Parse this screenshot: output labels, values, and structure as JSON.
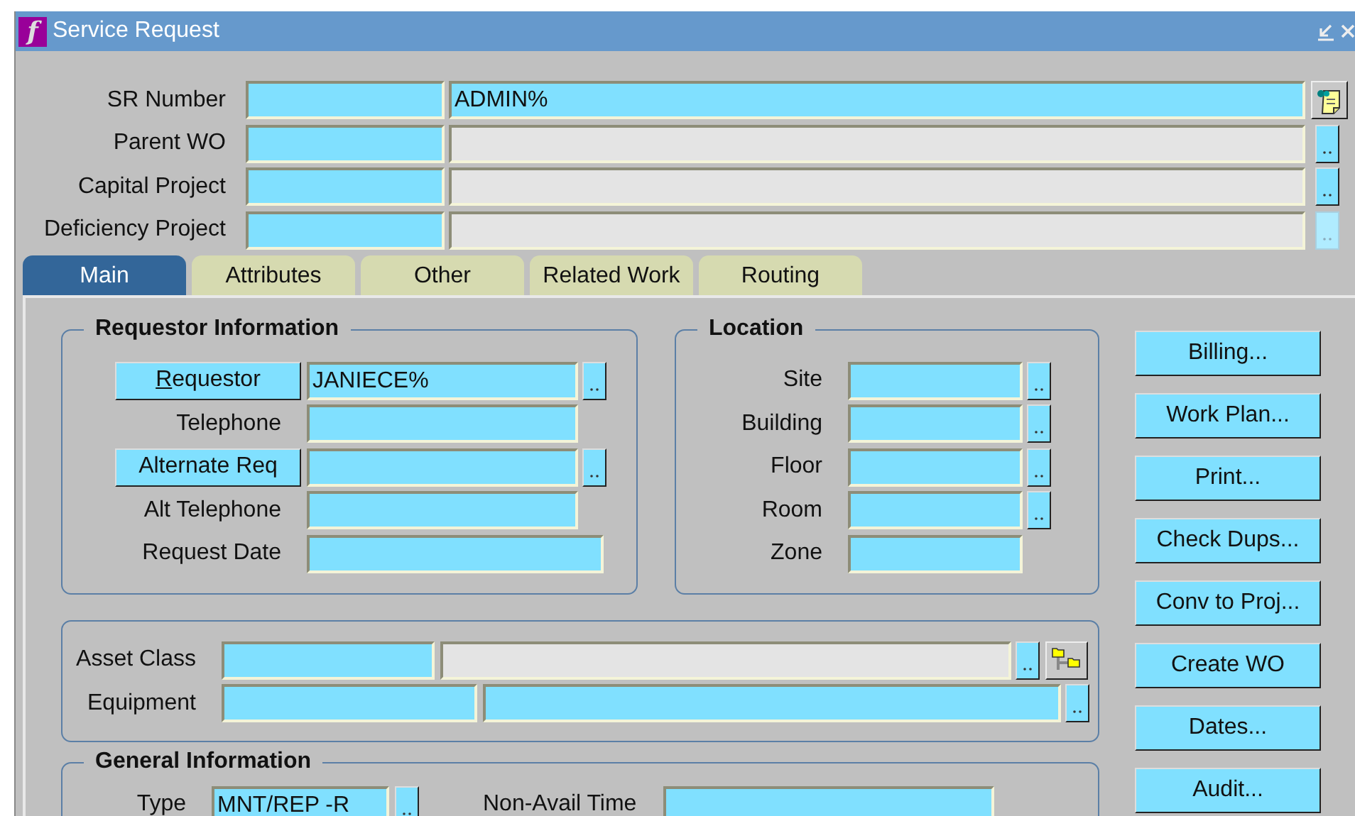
{
  "window": {
    "logo": "f",
    "title": "Service Request"
  },
  "header_fields": [
    {
      "label": "SR Number",
      "description": "ADMIN%",
      "editable": true,
      "action": {
        "kind": "notes",
        "disabled": false
      }
    },
    {
      "label": "Parent WO",
      "editable": false,
      "action": {
        "kind": "lov",
        "disabled": false
      }
    },
    {
      "label": "Capital Project",
      "editable": false,
      "action": {
        "kind": "lov",
        "disabled": false
      }
    },
    {
      "label": "Deficiency Project",
      "editable": false,
      "action": {
        "kind": "lov",
        "disabled": true
      }
    }
  ],
  "tabs": [
    {
      "label": "Main",
      "selected": true
    },
    {
      "label": "Attributes",
      "selected": false
    },
    {
      "label": "Other",
      "selected": false
    },
    {
      "label": "Related Work",
      "selected": false
    },
    {
      "label": "Routing",
      "selected": false
    }
  ],
  "requestor_information": {
    "title": "Requestor Information",
    "rows": [
      {
        "label": "Requestor",
        "kind": "button",
        "underline_first": true,
        "value": "JANIECE%",
        "lov": true
      },
      {
        "label": "Telephone",
        "kind": "text",
        "lov": false
      },
      {
        "label": "Alternate Req",
        "kind": "button",
        "underline_first": false,
        "lov": true
      },
      {
        "label": "Alt Telephone",
        "kind": "text",
        "lov": false
      },
      {
        "label": "Request Date",
        "kind": "text",
        "lov": false
      }
    ]
  },
  "location": {
    "title": "Location",
    "rows": [
      {
        "label": "Site",
        "lov": true
      },
      {
        "label": "Building",
        "lov": true
      },
      {
        "label": "Floor",
        "lov": true
      },
      {
        "label": "Room",
        "lov": true
      },
      {
        "label": "Zone",
        "lov": false
      }
    ]
  },
  "asset": {
    "rows": [
      {
        "label": "Asset Class",
        "kind": "class",
        "editable": false,
        "lov": true,
        "tree": true
      },
      {
        "label": "Equipment",
        "kind": "equipment",
        "editable": true,
        "lov": true,
        "tree": false
      }
    ]
  },
  "general_information": {
    "title": "General Information",
    "fields": [
      {
        "label": "Type",
        "value": "MNT/REP -R",
        "lov": true
      },
      {
        "label": "Non-Avail Time",
        "lov": false
      }
    ]
  },
  "action_buttons": [
    "Billing...",
    "Work Plan...",
    "Print...",
    "Check Dups...",
    "Conv to Proj...",
    "Create WO",
    "Dates...",
    "Audit..."
  ]
}
